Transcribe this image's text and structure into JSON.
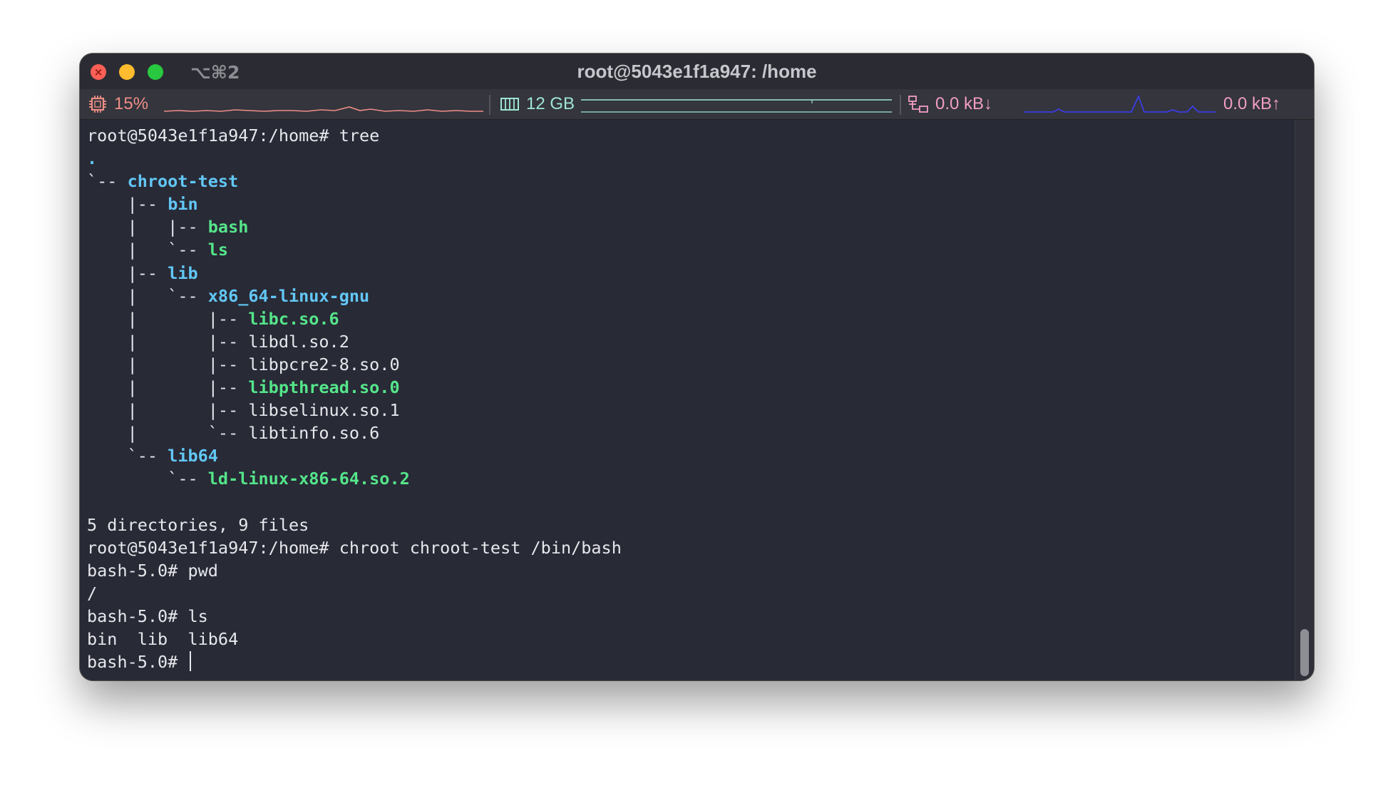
{
  "window": {
    "title": "root@5043e1f1a947: /home",
    "shortcut": "⌥⌘2"
  },
  "status": {
    "cpu": {
      "icon": "cpu-chip-icon",
      "value": "15%",
      "color": "#ee8e85"
    },
    "memory": {
      "icon": "memory-icon",
      "value": "12 GB",
      "color": "#9ee6d3"
    },
    "network": {
      "icon": "network-icon",
      "down": "0.0 kB↓",
      "up": "0.0 kB↑",
      "color": "#f29dc4"
    }
  },
  "colors": {
    "directory": "#62c7f5",
    "executable": "#55e58a",
    "text": "#e7e8ec",
    "background": "#282a36"
  },
  "terminal": {
    "lines": [
      [
        {
          "t": "root@5043e1f1a947:/home# tree"
        }
      ],
      [
        {
          "t": ".",
          "c": "dir"
        }
      ],
      [
        {
          "t": "`-- "
        },
        {
          "t": "chroot-test",
          "c": "dir"
        }
      ],
      [
        {
          "t": "    |-- "
        },
        {
          "t": "bin",
          "c": "dir"
        }
      ],
      [
        {
          "t": "    |   |-- "
        },
        {
          "t": "bash",
          "c": "exe"
        }
      ],
      [
        {
          "t": "    |   `-- "
        },
        {
          "t": "ls",
          "c": "exe"
        }
      ],
      [
        {
          "t": "    |-- "
        },
        {
          "t": "lib",
          "c": "dir"
        }
      ],
      [
        {
          "t": "    |   `-- "
        },
        {
          "t": "x86_64-linux-gnu",
          "c": "dir"
        }
      ],
      [
        {
          "t": "    |       |-- "
        },
        {
          "t": "libc.so.6",
          "c": "exe"
        }
      ],
      [
        {
          "t": "    |       |-- libdl.so.2"
        }
      ],
      [
        {
          "t": "    |       |-- libpcre2-8.so.0"
        }
      ],
      [
        {
          "t": "    |       |-- "
        },
        {
          "t": "libpthread.so.0",
          "c": "exe"
        }
      ],
      [
        {
          "t": "    |       |-- libselinux.so.1"
        }
      ],
      [
        {
          "t": "    |       `-- libtinfo.so.6"
        }
      ],
      [
        {
          "t": "    `-- "
        },
        {
          "t": "lib64",
          "c": "dir"
        }
      ],
      [
        {
          "t": "        `-- "
        },
        {
          "t": "ld-linux-x86-64.so.2",
          "c": "exe"
        }
      ],
      [
        {
          "t": ""
        }
      ],
      [
        {
          "t": "5 directories, 9 files"
        }
      ],
      [
        {
          "t": "root@5043e1f1a947:/home# chroot chroot-test /bin/bash"
        }
      ],
      [
        {
          "t": "bash-5.0# pwd"
        }
      ],
      [
        {
          "t": "/"
        }
      ],
      [
        {
          "t": "bash-5.0# ls"
        }
      ],
      [
        {
          "t": "bin  lib  lib64"
        }
      ],
      [
        {
          "t": "bash-5.0# "
        }
      ]
    ]
  }
}
